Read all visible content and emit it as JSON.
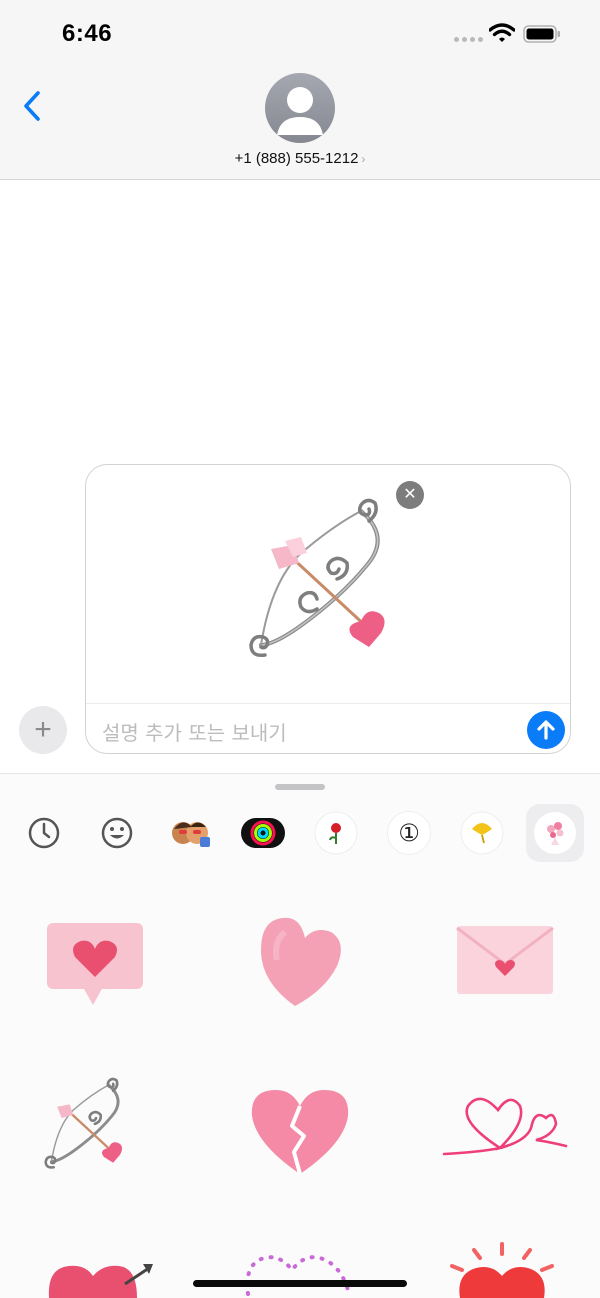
{
  "status_bar": {
    "time": "6:46",
    "icons": [
      "signal-dots-icon",
      "wifi-icon",
      "battery-icon"
    ]
  },
  "nav": {
    "back_icon": "chevron-left-icon",
    "contact_number": "+1 (888) 555-1212",
    "contact_chevron": "›"
  },
  "compose": {
    "placeholder": "설명 추가 또는 보내기",
    "remove_label": "✕",
    "plus_label": "+",
    "attached_sticker": "bow-and-arrow-heart-sticker"
  },
  "app_drawer": {
    "apps": [
      {
        "name": "recents",
        "icon": "clock-icon"
      },
      {
        "name": "emoji",
        "icon": "smiley-icon"
      },
      {
        "name": "memoji",
        "icon": "memoji-stickers-icon"
      },
      {
        "name": "activity",
        "icon": "activity-rings-icon"
      },
      {
        "name": "rose",
        "icon": "rose-icon"
      },
      {
        "name": "number-one",
        "icon": "circled-one-icon",
        "label": "①"
      },
      {
        "name": "ginkgo",
        "icon": "ginkgo-leaf-icon"
      },
      {
        "name": "valentine-stickers",
        "icon": "bouquet-icon",
        "selected": true
      }
    ],
    "stickers": [
      "heart-speech-bubble-sticker",
      "pink-heart-sticker",
      "heart-envelope-sticker",
      "bow-and-arrow-sticker",
      "broken-heart-sticker",
      "heart-line-sticker",
      "heart-with-arrow-sticker",
      "dotted-hearts-sticker",
      "glowing-heart-sticker"
    ]
  },
  "colors": {
    "accent": "#0a7cf7",
    "nav_bg": "#f6f6f6",
    "sticker_pink": "#ee5f86"
  }
}
